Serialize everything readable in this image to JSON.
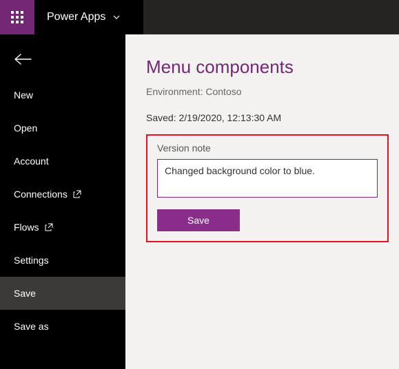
{
  "header": {
    "app_name": "Power Apps"
  },
  "sidebar": {
    "items": [
      {
        "label": "New",
        "external": false
      },
      {
        "label": "Open",
        "external": false
      },
      {
        "label": "Account",
        "external": false
      },
      {
        "label": "Connections",
        "external": true
      },
      {
        "label": "Flows",
        "external": true
      },
      {
        "label": "Settings",
        "external": false
      },
      {
        "label": "Save",
        "external": false,
        "active": true
      },
      {
        "label": "Save as",
        "external": false
      }
    ]
  },
  "main": {
    "title": "Menu components",
    "environment_label": "Environment:",
    "environment_value": "Contoso",
    "saved_label": "Saved:",
    "saved_value": "2/19/2020, 12:13:30 AM",
    "version_note_label": "Version note",
    "version_note_value": "Changed background color to blue.",
    "save_button_label": "Save"
  },
  "colors": {
    "brand": "#742774",
    "highlight": "#e81123"
  }
}
